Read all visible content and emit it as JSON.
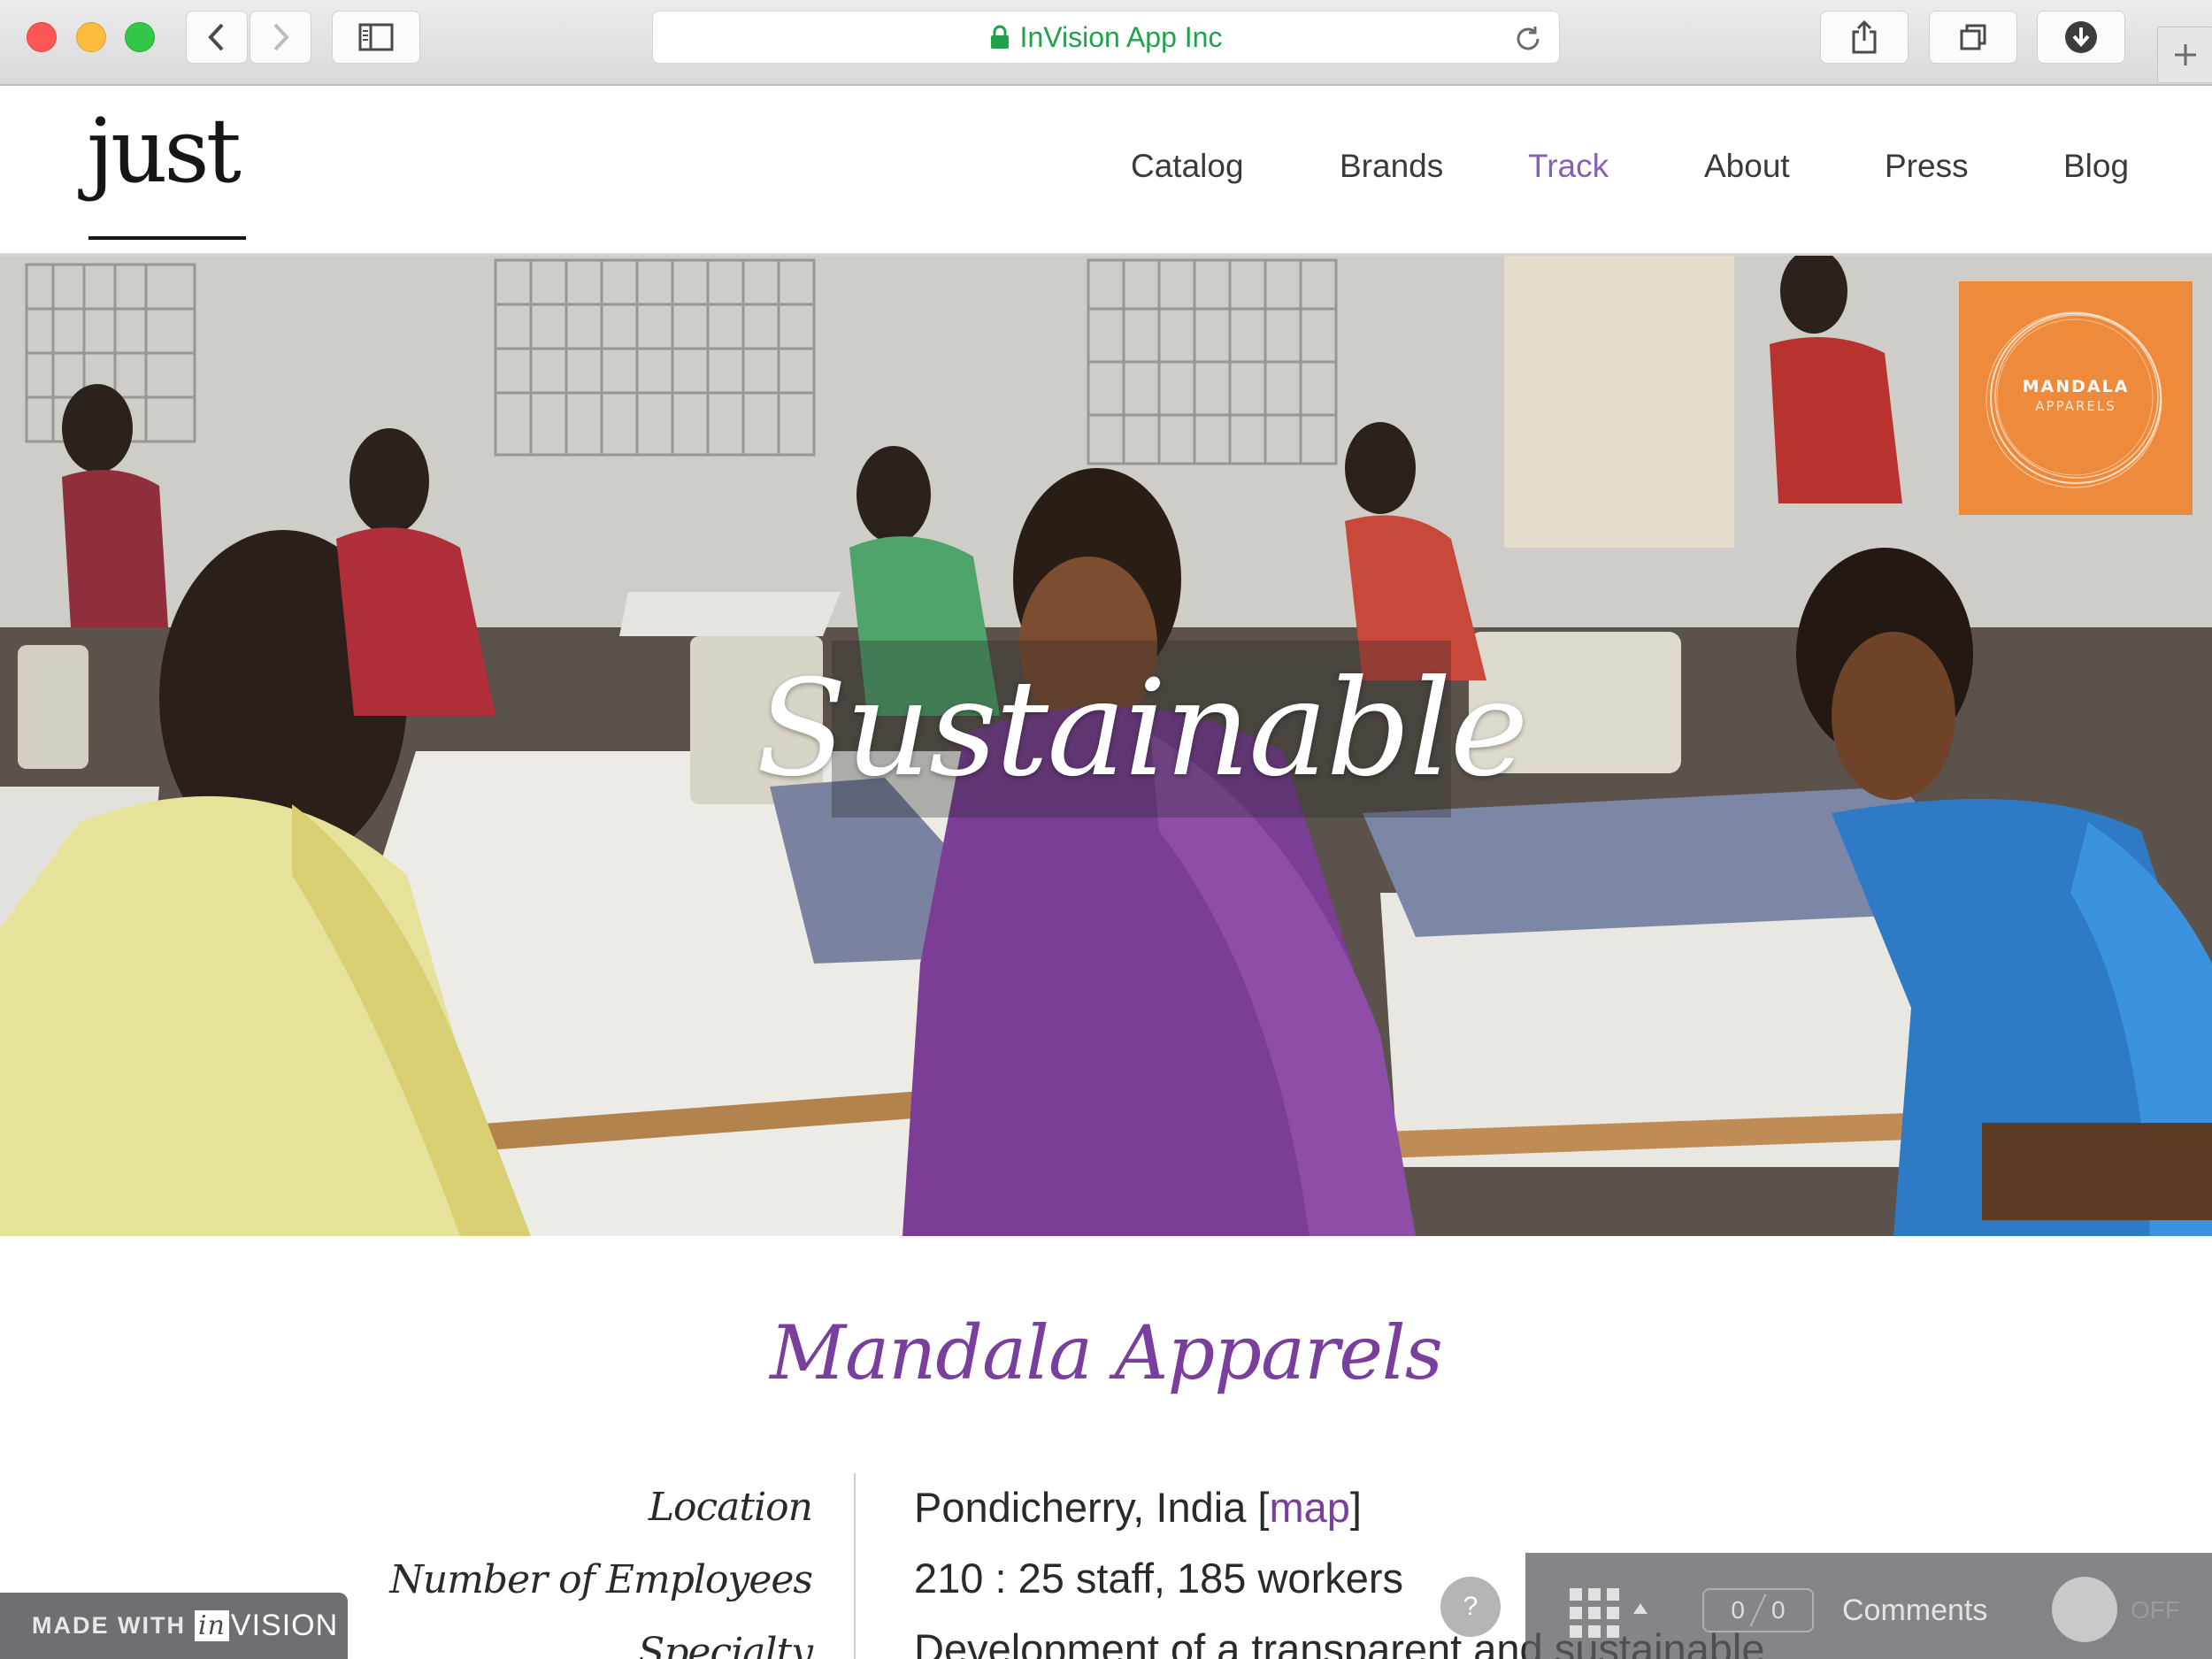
{
  "browser": {
    "address": "InVision App Inc",
    "icons": [
      "back-icon",
      "forward-icon",
      "sidebar-icon",
      "lock-icon",
      "reload-icon",
      "share-icon",
      "tabs-icon",
      "download-icon",
      "new-tab-icon"
    ]
  },
  "site": {
    "logo_text": "just",
    "nav": [
      {
        "label": "Catalog"
      },
      {
        "label": "Brands"
      },
      {
        "label": "Track"
      },
      {
        "label": "About"
      },
      {
        "label": "Press"
      },
      {
        "label": "Blog"
      }
    ],
    "active_nav": "Track",
    "accent_color": "#8a5fb6"
  },
  "hero": {
    "title": "Sustainable",
    "badge_line1": "MANDALA",
    "badge_line2": "APPARELS",
    "badge_color": "#ee8a3b"
  },
  "brand": {
    "name": "Mandala Apparels",
    "details": [
      {
        "label": "Location",
        "value": "Pondicherry, India [",
        "link": "map",
        "suffix": "]"
      },
      {
        "label": "Number of Employees",
        "value": "210 : 25 staff, 185 workers"
      },
      {
        "label": "Specialty",
        "value": "Development of a transparent and sustainable"
      }
    ]
  },
  "overlay": {
    "made_with": "MADE WITH",
    "invision_in": "in",
    "invision_rest": "VISION",
    "help": "?",
    "comment_count": "0",
    "comment_total": "0",
    "comments_label": "Comments",
    "toggle_label": "OFF"
  }
}
